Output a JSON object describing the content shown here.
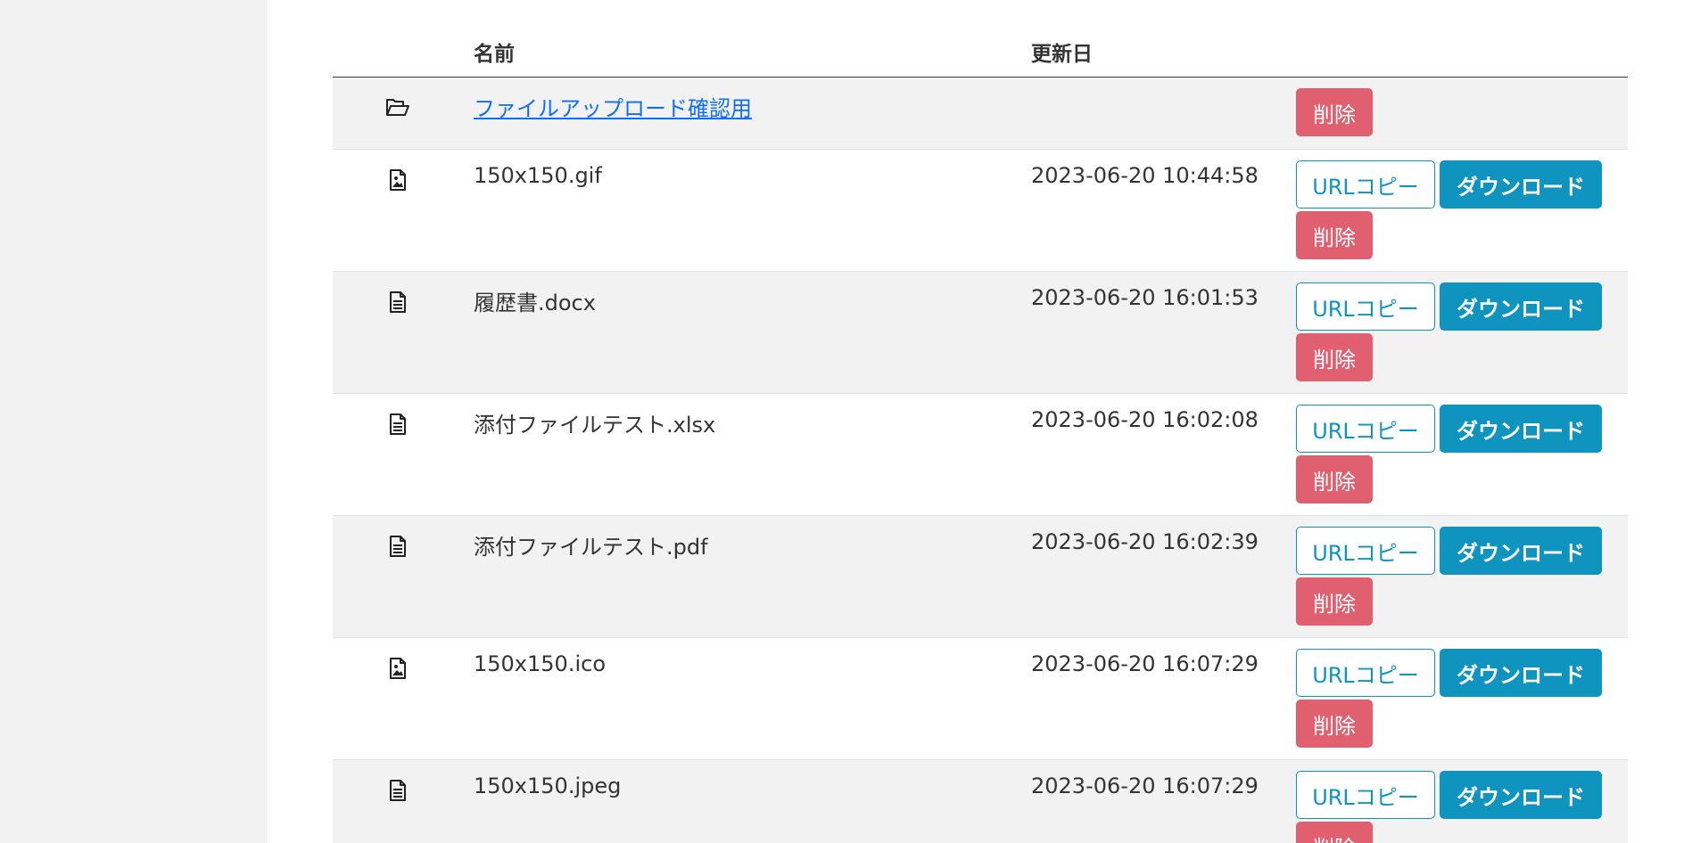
{
  "table": {
    "headers": {
      "icon": "",
      "name": "名前",
      "date": "更新日",
      "actions": ""
    },
    "rows": [
      {
        "type": "folder",
        "icon": "folder-open-icon",
        "name": "ファイルアップロード確認用",
        "date": "",
        "delete_label": "削除"
      },
      {
        "type": "file",
        "icon": "file-image-icon",
        "name": "150x150.gif",
        "date": "2023-06-20 10:44:58",
        "copy_label": "URLコピー",
        "download_label": "ダウンロード",
        "delete_label": "削除"
      },
      {
        "type": "file",
        "icon": "file-text-icon",
        "name": "履歴書.docx",
        "date": "2023-06-20 16:01:53",
        "copy_label": "URLコピー",
        "download_label": "ダウンロード",
        "delete_label": "削除"
      },
      {
        "type": "file",
        "icon": "file-text-icon",
        "name": "添付ファイルテスト.xlsx",
        "date": "2023-06-20 16:02:08",
        "copy_label": "URLコピー",
        "download_label": "ダウンロード",
        "delete_label": "削除"
      },
      {
        "type": "file",
        "icon": "file-text-icon",
        "name": "添付ファイルテスト.pdf",
        "date": "2023-06-20 16:02:39",
        "copy_label": "URLコピー",
        "download_label": "ダウンロード",
        "delete_label": "削除"
      },
      {
        "type": "file",
        "icon": "file-image-icon",
        "name": "150x150.ico",
        "date": "2023-06-20 16:07:29",
        "copy_label": "URLコピー",
        "download_label": "ダウンロード",
        "delete_label": "削除"
      },
      {
        "type": "file",
        "icon": "file-text-icon",
        "name": "150x150.jpeg",
        "date": "2023-06-20 16:07:29",
        "copy_label": "URLコピー",
        "download_label": "ダウンロード",
        "delete_label": "削除"
      }
    ]
  },
  "colors": {
    "sidebar_bg": "#f2f2f2",
    "stripe_bg": "#f2f2f2",
    "link": "#0d6efd",
    "primary": "#0f94bf",
    "danger": "#e06070"
  }
}
